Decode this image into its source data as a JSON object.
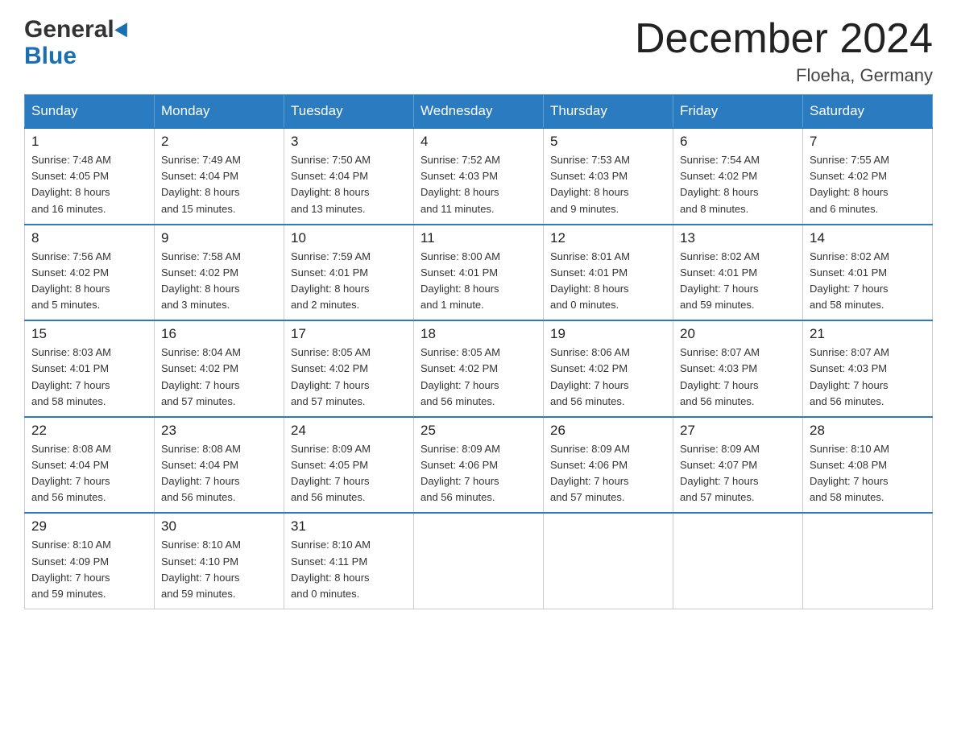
{
  "header": {
    "logo_general": "General",
    "logo_blue": "Blue",
    "title": "December 2024",
    "subtitle": "Floeha, Germany"
  },
  "days_of_week": [
    "Sunday",
    "Monday",
    "Tuesday",
    "Wednesday",
    "Thursday",
    "Friday",
    "Saturday"
  ],
  "weeks": [
    [
      {
        "day": "1",
        "info": "Sunrise: 7:48 AM\nSunset: 4:05 PM\nDaylight: 8 hours\nand 16 minutes."
      },
      {
        "day": "2",
        "info": "Sunrise: 7:49 AM\nSunset: 4:04 PM\nDaylight: 8 hours\nand 15 minutes."
      },
      {
        "day": "3",
        "info": "Sunrise: 7:50 AM\nSunset: 4:04 PM\nDaylight: 8 hours\nand 13 minutes."
      },
      {
        "day": "4",
        "info": "Sunrise: 7:52 AM\nSunset: 4:03 PM\nDaylight: 8 hours\nand 11 minutes."
      },
      {
        "day": "5",
        "info": "Sunrise: 7:53 AM\nSunset: 4:03 PM\nDaylight: 8 hours\nand 9 minutes."
      },
      {
        "day": "6",
        "info": "Sunrise: 7:54 AM\nSunset: 4:02 PM\nDaylight: 8 hours\nand 8 minutes."
      },
      {
        "day": "7",
        "info": "Sunrise: 7:55 AM\nSunset: 4:02 PM\nDaylight: 8 hours\nand 6 minutes."
      }
    ],
    [
      {
        "day": "8",
        "info": "Sunrise: 7:56 AM\nSunset: 4:02 PM\nDaylight: 8 hours\nand 5 minutes."
      },
      {
        "day": "9",
        "info": "Sunrise: 7:58 AM\nSunset: 4:02 PM\nDaylight: 8 hours\nand 3 minutes."
      },
      {
        "day": "10",
        "info": "Sunrise: 7:59 AM\nSunset: 4:01 PM\nDaylight: 8 hours\nand 2 minutes."
      },
      {
        "day": "11",
        "info": "Sunrise: 8:00 AM\nSunset: 4:01 PM\nDaylight: 8 hours\nand 1 minute."
      },
      {
        "day": "12",
        "info": "Sunrise: 8:01 AM\nSunset: 4:01 PM\nDaylight: 8 hours\nand 0 minutes."
      },
      {
        "day": "13",
        "info": "Sunrise: 8:02 AM\nSunset: 4:01 PM\nDaylight: 7 hours\nand 59 minutes."
      },
      {
        "day": "14",
        "info": "Sunrise: 8:02 AM\nSunset: 4:01 PM\nDaylight: 7 hours\nand 58 minutes."
      }
    ],
    [
      {
        "day": "15",
        "info": "Sunrise: 8:03 AM\nSunset: 4:01 PM\nDaylight: 7 hours\nand 58 minutes."
      },
      {
        "day": "16",
        "info": "Sunrise: 8:04 AM\nSunset: 4:02 PM\nDaylight: 7 hours\nand 57 minutes."
      },
      {
        "day": "17",
        "info": "Sunrise: 8:05 AM\nSunset: 4:02 PM\nDaylight: 7 hours\nand 57 minutes."
      },
      {
        "day": "18",
        "info": "Sunrise: 8:05 AM\nSunset: 4:02 PM\nDaylight: 7 hours\nand 56 minutes."
      },
      {
        "day": "19",
        "info": "Sunrise: 8:06 AM\nSunset: 4:02 PM\nDaylight: 7 hours\nand 56 minutes."
      },
      {
        "day": "20",
        "info": "Sunrise: 8:07 AM\nSunset: 4:03 PM\nDaylight: 7 hours\nand 56 minutes."
      },
      {
        "day": "21",
        "info": "Sunrise: 8:07 AM\nSunset: 4:03 PM\nDaylight: 7 hours\nand 56 minutes."
      }
    ],
    [
      {
        "day": "22",
        "info": "Sunrise: 8:08 AM\nSunset: 4:04 PM\nDaylight: 7 hours\nand 56 minutes."
      },
      {
        "day": "23",
        "info": "Sunrise: 8:08 AM\nSunset: 4:04 PM\nDaylight: 7 hours\nand 56 minutes."
      },
      {
        "day": "24",
        "info": "Sunrise: 8:09 AM\nSunset: 4:05 PM\nDaylight: 7 hours\nand 56 minutes."
      },
      {
        "day": "25",
        "info": "Sunrise: 8:09 AM\nSunset: 4:06 PM\nDaylight: 7 hours\nand 56 minutes."
      },
      {
        "day": "26",
        "info": "Sunrise: 8:09 AM\nSunset: 4:06 PM\nDaylight: 7 hours\nand 57 minutes."
      },
      {
        "day": "27",
        "info": "Sunrise: 8:09 AM\nSunset: 4:07 PM\nDaylight: 7 hours\nand 57 minutes."
      },
      {
        "day": "28",
        "info": "Sunrise: 8:10 AM\nSunset: 4:08 PM\nDaylight: 7 hours\nand 58 minutes."
      }
    ],
    [
      {
        "day": "29",
        "info": "Sunrise: 8:10 AM\nSunset: 4:09 PM\nDaylight: 7 hours\nand 59 minutes."
      },
      {
        "day": "30",
        "info": "Sunrise: 8:10 AM\nSunset: 4:10 PM\nDaylight: 7 hours\nand 59 minutes."
      },
      {
        "day": "31",
        "info": "Sunrise: 8:10 AM\nSunset: 4:11 PM\nDaylight: 8 hours\nand 0 minutes."
      },
      null,
      null,
      null,
      null
    ]
  ]
}
